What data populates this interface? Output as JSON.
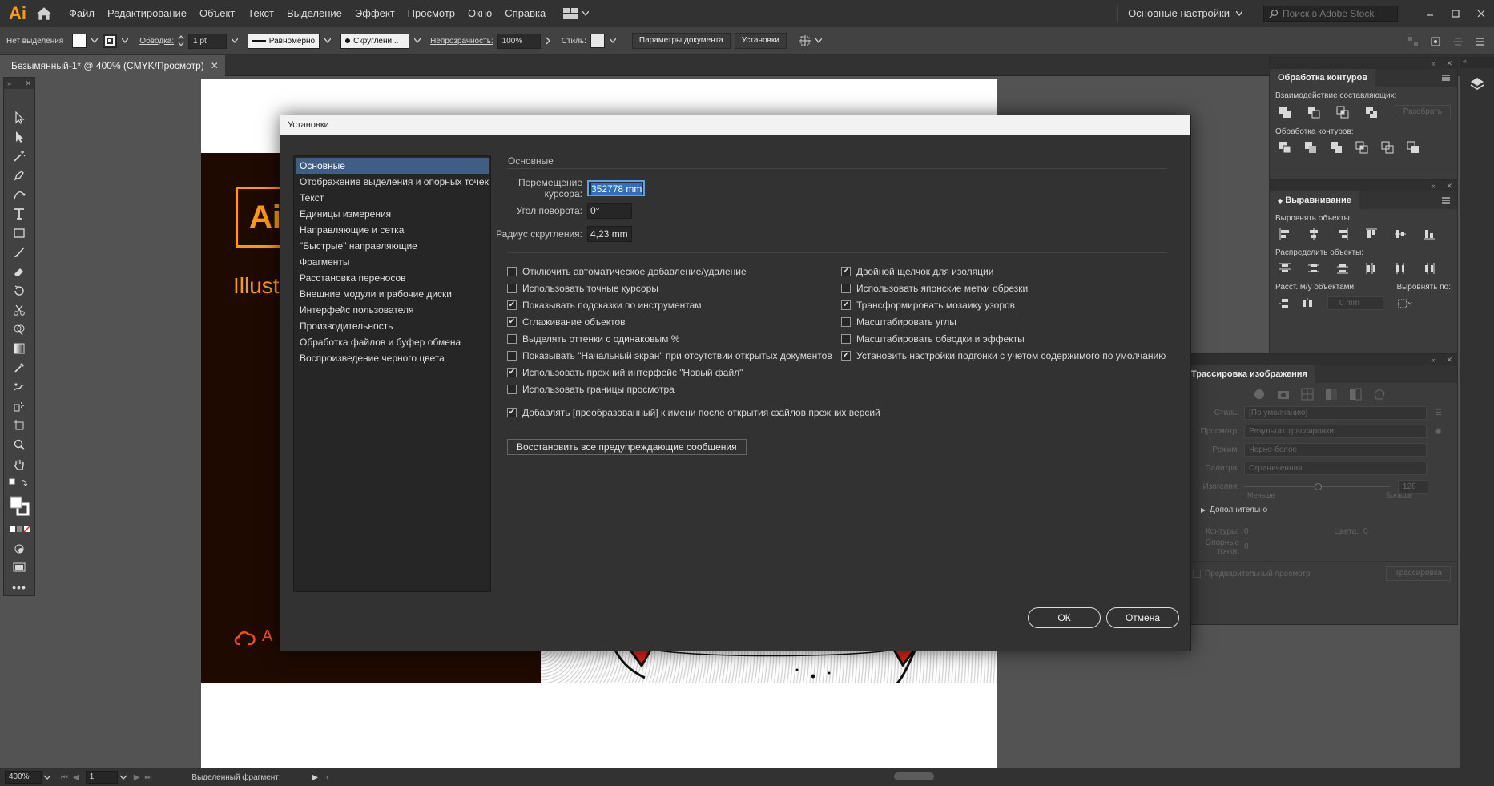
{
  "app": {
    "logo": "Ai",
    "menu": [
      "Файл",
      "Редактирование",
      "Объект",
      "Текст",
      "Выделение",
      "Эффект",
      "Просмотр",
      "Окно",
      "Справка"
    ],
    "workspace": "Основные настройки",
    "stock_placeholder": "Поиск в Adobe Stock"
  },
  "controlbar": {
    "selection": "Нет выделения",
    "stroke_label": "Обводка:",
    "stroke_weight": "1 pt",
    "profile": "Равномерно",
    "brush": "Скруглени...",
    "opacity_label": "Непрозрачность:",
    "opacity": "100%",
    "style_label": "Стиль:",
    "doc_params": "Параметры документа",
    "prefs": "Установки"
  },
  "document": {
    "tab": "Безымянный-1* @ 400% (CMYK/Просмотр)",
    "splash_logo": "Ai",
    "splash_sub": "Illust",
    "splash_cc": "A"
  },
  "statusbar": {
    "zoom": "400%",
    "page": "1",
    "status": "Выделенный фрагмент"
  },
  "panels": {
    "pathfinder": {
      "title": "Обработка контуров",
      "shape_modes": "Взаимодействие составляющих:",
      "expand": "Разобрать",
      "pathfinders": "Обработка контуров:"
    },
    "align": {
      "title": "Выравнивание",
      "align_objects": "Выровнять объекты:",
      "distribute_objects": "Распределить объекты:",
      "distribute_spacing": "Расст. м/у объектами",
      "align_to": "Выровнять по:",
      "spacing_value": "0 mm"
    },
    "trace": {
      "title": "Трассировка изображения",
      "preset_label": "Стиль:",
      "preset": "[По умолчанию]",
      "view_label": "Просмотр:",
      "view": "Результат трассировки",
      "mode_label": "Режим:",
      "mode": "Черно-белое",
      "palette_label": "Палитра:",
      "palette": "Ограниченная",
      "threshold_label": "Изогелия:",
      "threshold_value": "128",
      "less": "Меньше",
      "more": "Больше",
      "advanced": "Дополнительно",
      "paths_label": "Контуры:",
      "paths": "0",
      "colors_label": "Цвета:",
      "colors": "0",
      "anchors_label": "Опорные точки:",
      "anchors": "0",
      "preview": "Предварительный просмотр",
      "trace_button": "Трассировка"
    }
  },
  "dialog": {
    "title": "Установки",
    "nav": [
      "Основные",
      "Отображение выделения и опорных точек",
      "Текст",
      "Единицы измерения",
      "Направляющие и сетка",
      "\"Быстрые\" направляющие",
      "Фрагменты",
      "Расстановка переносов",
      "Внешние модули и рабочие диски",
      "Интерфейс пользователя",
      "Производительность",
      "Обработка файлов и буфер обмена",
      "Воспроизведение черного цвета"
    ],
    "section": "Основные",
    "keyboard_increment_label": "Перемещение курсора:",
    "keyboard_increment": "352778 mm",
    "constrain_angle_label": "Угол поворота:",
    "constrain_angle": "0°",
    "corner_radius_label": "Радиус скругления:",
    "corner_radius": "4,23 mm",
    "checks_left": [
      {
        "label": "Отключить автоматическое добавление/удаление",
        "checked": false
      },
      {
        "label": "Использовать точные курсоры",
        "checked": false
      },
      {
        "label": "Показывать подсказки по инструментам",
        "checked": true
      },
      {
        "label": "Сглаживание объектов",
        "checked": true
      },
      {
        "label": "Выделять оттенки с одинаковым %",
        "checked": false
      },
      {
        "label": "Показывать \"Начальный экран\" при отсутствии открытых документов",
        "checked": false
      },
      {
        "label": "Использовать прежний интерфейс \"Новый файл\"",
        "checked": true
      },
      {
        "label": "Использовать границы просмотра",
        "checked": false
      }
    ],
    "checks_right": [
      {
        "label": "Двойной щелчок для изоляции",
        "checked": true
      },
      {
        "label": "Использовать японские метки обрезки",
        "checked": false
      },
      {
        "label": "Трансформировать мозаику узоров",
        "checked": true
      },
      {
        "label": "Масштабировать углы",
        "checked": false
      },
      {
        "label": "Масштабировать обводки и эффекты",
        "checked": false
      },
      {
        "label": "Установить настройки подгонки с учетом содержимого по умолчанию",
        "checked": true
      }
    ],
    "check_append": {
      "label": "Добавлять [преобразованный] к имени после открытия файлов прежних версий",
      "checked": true
    },
    "reset_warnings": "Восстановить все предупреждающие сообщения",
    "ok": "ОК",
    "cancel": "Отмена"
  }
}
